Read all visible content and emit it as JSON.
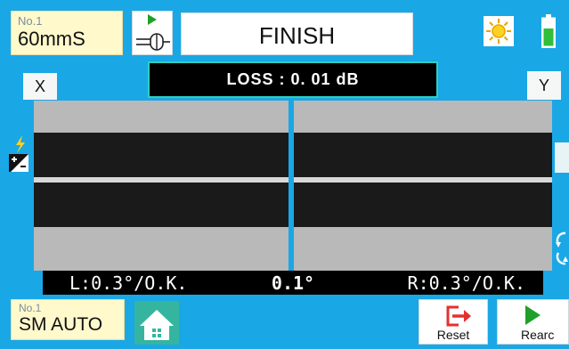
{
  "program": {
    "number": "No.1",
    "name": "60mmS"
  },
  "status": {
    "title": "FINISH"
  },
  "measurement": {
    "loss_text": "LOSS : 0. 01 dB",
    "left_angle": "L:0.3°/O.K.",
    "center_angle": "0.1°",
    "right_angle": "R:0.3°/O.K."
  },
  "camera": {
    "x_label": "X",
    "y_label": "Y"
  },
  "mode": {
    "number": "No.1",
    "name": "SM AUTO"
  },
  "buttons": {
    "reset_label": "Reset",
    "rearc_label": "Rearc"
  },
  "icons": {
    "fiber": "fiber-connector-icon",
    "brightness": "sun-icon",
    "battery": "battery-icon",
    "home": "home-icon",
    "reset": "exit-arrow-icon",
    "rearc": "play-triangle-icon",
    "arc_adjust": "lightning-plusminus-icon"
  },
  "colors": {
    "background": "#1aa7e6",
    "accent_green": "#1fa02b",
    "reset_red": "#e53030",
    "loss_border": "#2ecfc0",
    "label_yellow": "#fff9cc"
  }
}
